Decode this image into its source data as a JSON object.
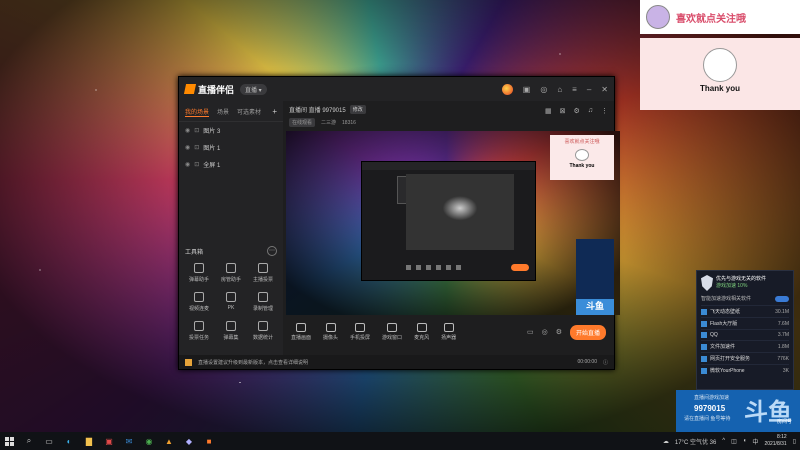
{
  "app": {
    "name": "直播伴侣",
    "version_badge": "直播 ▾",
    "tabs": [
      "我的场景",
      "场景",
      "可选素材"
    ],
    "scene_items": [
      "图片 3",
      "图片 1",
      "全屏 1"
    ],
    "tools_title": "工具箱",
    "tools": [
      "弹幕助手",
      "房管助手",
      "主播投票",
      "视频连麦",
      "PK",
      "录制管理",
      "投票任务",
      "弹幕集",
      "数据统计",
      "猜你想玩"
    ],
    "room_line": "直播间 直播 9979015",
    "room_btn": "修改",
    "room_category": "在线观看",
    "room_sub1": "二三游",
    "room_sub2": "18316",
    "bottom_tools": [
      "直播画面",
      "摄像头",
      "手机投屏",
      "游戏窗口",
      "麦克风",
      "扬声器"
    ],
    "live_button": "开始直播",
    "status_text": "直播设置建议升级到最新版本，点击查看详细说明",
    "time_text": "00:00:00"
  },
  "overlay": {
    "top_text": "喜欢就点关注哦",
    "main_text": "Thank you",
    "mini_top": "喜欢就点关注哦",
    "mini_main": "Thank you"
  },
  "popup": {
    "title": "优先与游戏无关的软件",
    "subtitle": "游戏加速 10%",
    "toggle_label": "智能加速游戏相关软件",
    "items": [
      {
        "name": "飞天动态壁纸",
        "mem": "30.1M"
      },
      {
        "name": "Flash大厅版",
        "mem": "7.6M"
      },
      {
        "name": "QQ",
        "mem": "3.7M"
      },
      {
        "name": "文件加速件",
        "mem": "1.8M"
      },
      {
        "name": "网页打开安全服务",
        "mem": "776K"
      },
      {
        "name": "微软YourPhone",
        "mem": "3K"
      }
    ]
  },
  "ad": {
    "line1": "直播间游戏加速",
    "room_id": "9979015",
    "line2": "请在直播间 鱼号等待",
    "big_text": "斗鱼",
    "room_tag": "房间号"
  },
  "taskbar": {
    "weather": "17°C 空气优 36",
    "time": "8:12",
    "date": "2021/8/31"
  },
  "colors": {
    "accent": "#ff7a2b",
    "ad_blue": "#1562b0"
  }
}
